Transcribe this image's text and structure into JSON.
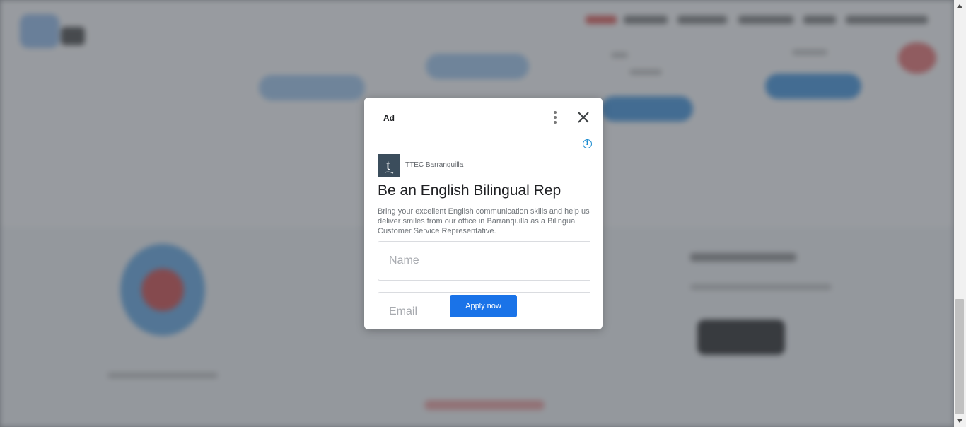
{
  "ad": {
    "label": "Ad",
    "advertiser": "TTEC Barranquilla",
    "headline": "Be an English Bilingual Rep",
    "body": "Bring your excellent English communication skills and help us deliver smiles from our office in Barranquilla as a Bilingual Customer Service Representative.",
    "name_placeholder": "Name",
    "email_placeholder": "Email",
    "apply_label": "Apply now",
    "info_symbol": "i",
    "logo_letter": "t",
    "logo_color": "#3b4d5c",
    "accent_color": "#1a73e8",
    "icons": [
      "kebab-menu-icon",
      "close-icon",
      "info-icon"
    ]
  }
}
